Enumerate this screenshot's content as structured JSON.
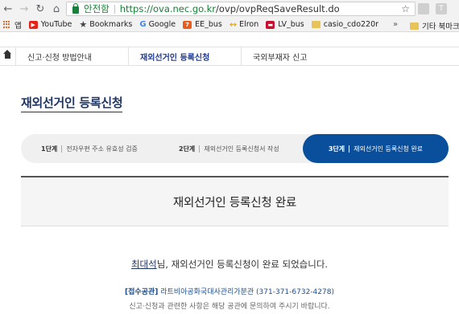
{
  "browser": {
    "secure_label": "안전함",
    "url_host": "https://ova.nec.go.kr",
    "url_path": "/ovp/ovpReqSaveResult.do",
    "ext1": "",
    "ext2": "T"
  },
  "bookmarks": {
    "items": [
      {
        "label": "앱",
        "icon": "apps-icon"
      },
      {
        "label": "YouTube",
        "icon": "youtube-icon"
      },
      {
        "label": "Bookmarks",
        "icon": "star-icon"
      },
      {
        "label": "Google",
        "icon": "google-icon"
      },
      {
        "label": "EE_bus",
        "icon": "ee-icon"
      },
      {
        "label": "Elron",
        "icon": "elron-icon"
      },
      {
        "label": "LV_bus",
        "icon": "lv-icon"
      },
      {
        "label": "casio_cdo220r",
        "icon": "folder-icon"
      }
    ],
    "more": "»",
    "other_folder": "기타 북마크"
  },
  "site_nav": {
    "items": [
      {
        "label": "신고·신청 방법안내",
        "active": false
      },
      {
        "label": "재외선거인 등록신청",
        "active": true
      },
      {
        "label": "국외부재자 신고",
        "active": false
      }
    ]
  },
  "page": {
    "title": "재외선거인 등록신청",
    "steps": [
      {
        "num": "1단계",
        "text": "전자우편 주소 유효성 검증"
      },
      {
        "num": "2단계",
        "text": "재외선거인 등록신청서 작성"
      },
      {
        "num": "3단계",
        "text": "재외선거인 등록신청 완료"
      }
    ],
    "current_step": 3,
    "done_title": "재외선거인 등록신청 완료",
    "applicant_name": "최대석",
    "message_suffix": "님, 재외선거인 등록신청이 완료 되었습니다.",
    "office_label": "[접수공관]",
    "office_name": "라트비아공화국대사관리가분관 (371-371-6732-4278)",
    "notice": "신고·신청과 관련한 사항은 해당 공관에 문의하여 주시기 바랍니다."
  },
  "colors": {
    "accent": "#0a4f9c",
    "title": "#1f3562",
    "secure": "#188038"
  }
}
